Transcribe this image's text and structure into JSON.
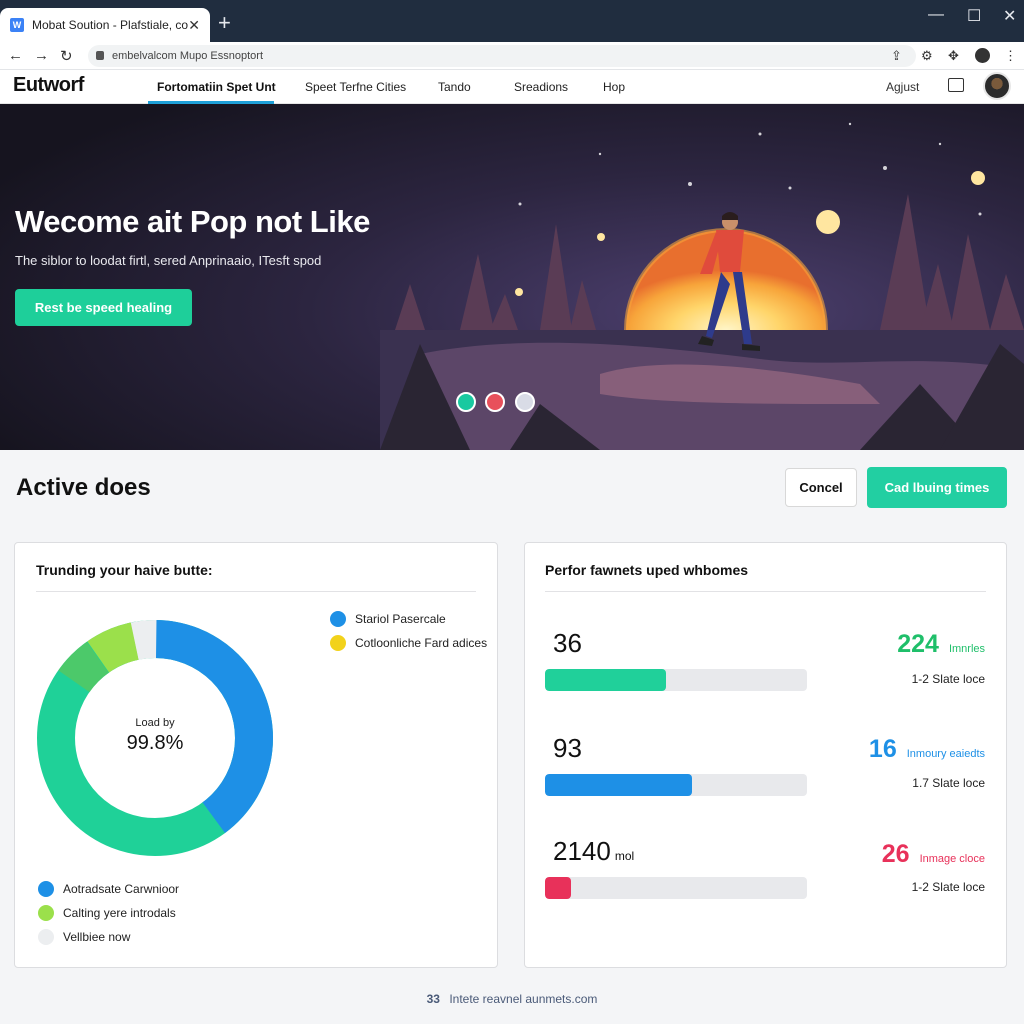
{
  "browser": {
    "tab_title": "Mobat Soution - Plafstiale, comf",
    "favicon_letter": "W",
    "url": "embelvalcom Mupo Essnoptort"
  },
  "site": {
    "logo": "Eutworf",
    "nav": [
      {
        "label": "Fortomatiin Spet Unt",
        "active": true
      },
      {
        "label": "Speet Terfne Cities"
      },
      {
        "label": "Tando"
      },
      {
        "label": "Sreadions"
      },
      {
        "label": "Hop"
      }
    ],
    "adjust_label": "Agjust"
  },
  "hero": {
    "title": "Wecome ait Pop not Like",
    "subtitle": "The siblor to loodat firtl, sered Anprinaaio, ITesft spod",
    "button_label": "Rest be speed healing",
    "carousel_dots": [
      "#19c9a0",
      "#e8505b",
      "#d9dce6"
    ]
  },
  "section": {
    "title": "Active does",
    "cancel_label": "Concel",
    "primary_label": "Cad lbuing times"
  },
  "left_card": {
    "title": "Trunding your haive butte:",
    "center_label": "Load by",
    "center_value": "99.8%",
    "legend_top": [
      {
        "label": "Stariol Pasercale",
        "color": "#1e90e6"
      },
      {
        "label": "Cotloonliche Fard adices",
        "color": "#f2d21b"
      }
    ],
    "legend_bottom": [
      {
        "label": "Aotradsate Carwnioor",
        "color": "#1e90e6"
      },
      {
        "label": "Calting yere introdals",
        "color": "#9be04b"
      },
      {
        "label": "Vellbiee now",
        "color": "#eceef0"
      }
    ]
  },
  "right_card": {
    "title": "Perfor fawnets uped whbomes",
    "stats": [
      {
        "value": "36",
        "unit": "",
        "fill": 0.46,
        "color": "#20d09a",
        "right_value": "224",
        "right_label": "Imnrles",
        "right_color": "#1fbf6a",
        "sub": "1-2 Slate loce"
      },
      {
        "value": "93",
        "unit": "",
        "fill": 0.56,
        "color": "#1e90e6",
        "right_value": "16",
        "right_label": "Inmoury eaiedts",
        "right_color": "#1e90e6",
        "sub": "1.7 Slate loce"
      },
      {
        "value": "2140",
        "unit": "mol",
        "fill": 0.1,
        "color": "#e8315a",
        "right_value": "26",
        "right_label": "Inmage cloce",
        "right_color": "#e8315a",
        "sub": "1-2 Slate loce"
      }
    ]
  },
  "footer": {
    "icon_text": "33",
    "text": "Intete reavnel aunmets.com"
  }
}
